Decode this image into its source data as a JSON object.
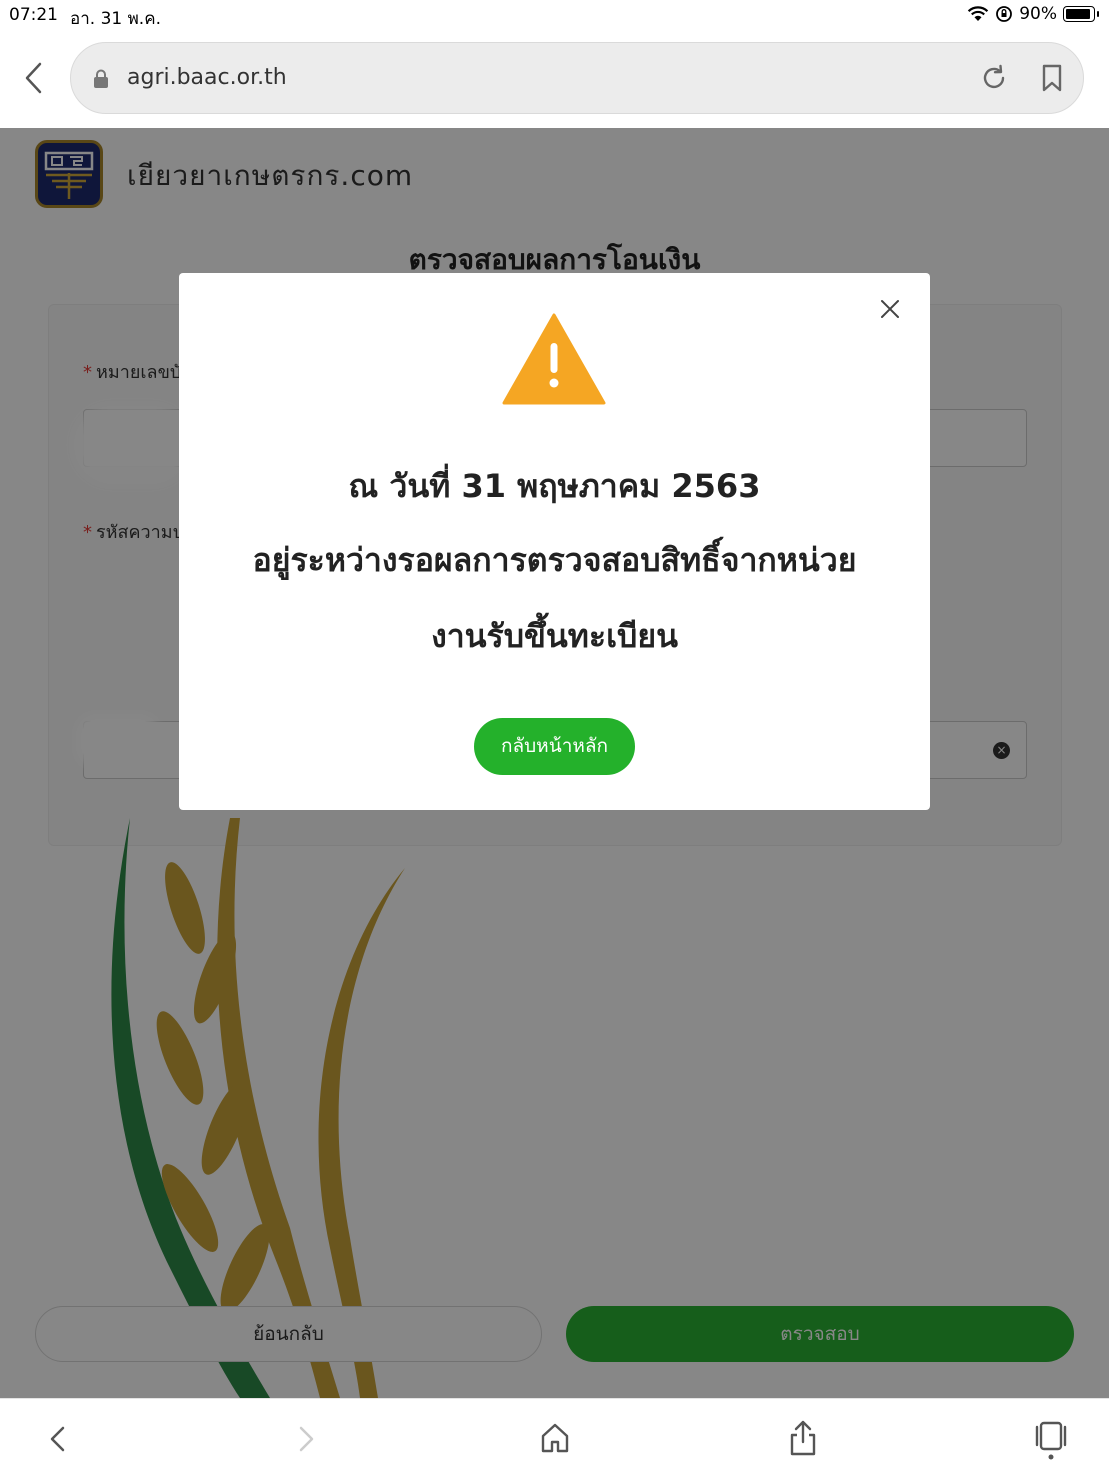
{
  "status_bar": {
    "time": "07:21",
    "date": "อา. 31 พ.ค.",
    "battery": "90%"
  },
  "browser": {
    "url": "agri.baac.or.th"
  },
  "page": {
    "site_title": "เยียวยาเกษตรกร.com",
    "title": "ตรวจสอบผลการโอนเงิน",
    "field1_label": "หมายเลขบัต",
    "field2_label": "รหัสความป",
    "back_button": "ย้อนกลับ",
    "check_button": "ตรวจสอบ"
  },
  "modal": {
    "line1": "ณ วันที่ 31 พฤษภาคม 2563",
    "line2": "อยู่ระหว่างรอผลการตรวจสอบสิทธิ์จากหน่วย",
    "line3": "งานรับขึ้นทะเบียน",
    "button": "กลับหน้าหลัก",
    "warning_color": "#f5a623",
    "button_color": "#24b12b"
  }
}
